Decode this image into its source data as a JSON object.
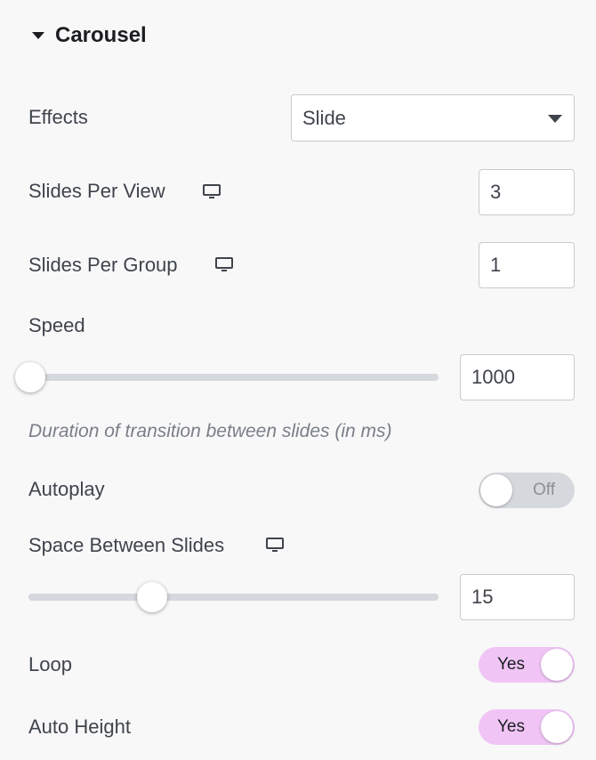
{
  "section": {
    "title": "Carousel",
    "expanded": true
  },
  "effects": {
    "label": "Effects",
    "value": "Slide",
    "options_visible": [
      "Slide"
    ]
  },
  "slides_per_view": {
    "label": "Slides Per View",
    "value": "3",
    "device_icon": "desktop-icon"
  },
  "slides_per_group": {
    "label": "Slides Per Group",
    "value": "1",
    "device_icon": "desktop-icon"
  },
  "speed": {
    "label": "Speed",
    "value": "1000",
    "slider_fraction": 0.0,
    "description": "Duration of transition between slides (in ms)"
  },
  "autoplay": {
    "label": "Autoplay",
    "state": "Off"
  },
  "space_between": {
    "label": "Space Between Slides",
    "value": "15",
    "slider_fraction": 0.3,
    "device_icon": "desktop-icon"
  },
  "loop": {
    "label": "Loop",
    "state": "Yes"
  },
  "auto_height": {
    "label": "Auto Height",
    "state": "Yes"
  },
  "colors": {
    "toggle_on": "#f0c5f6",
    "toggle_off": "#d5d8dc",
    "text": "#3f444b",
    "heading": "#1b1d20"
  }
}
